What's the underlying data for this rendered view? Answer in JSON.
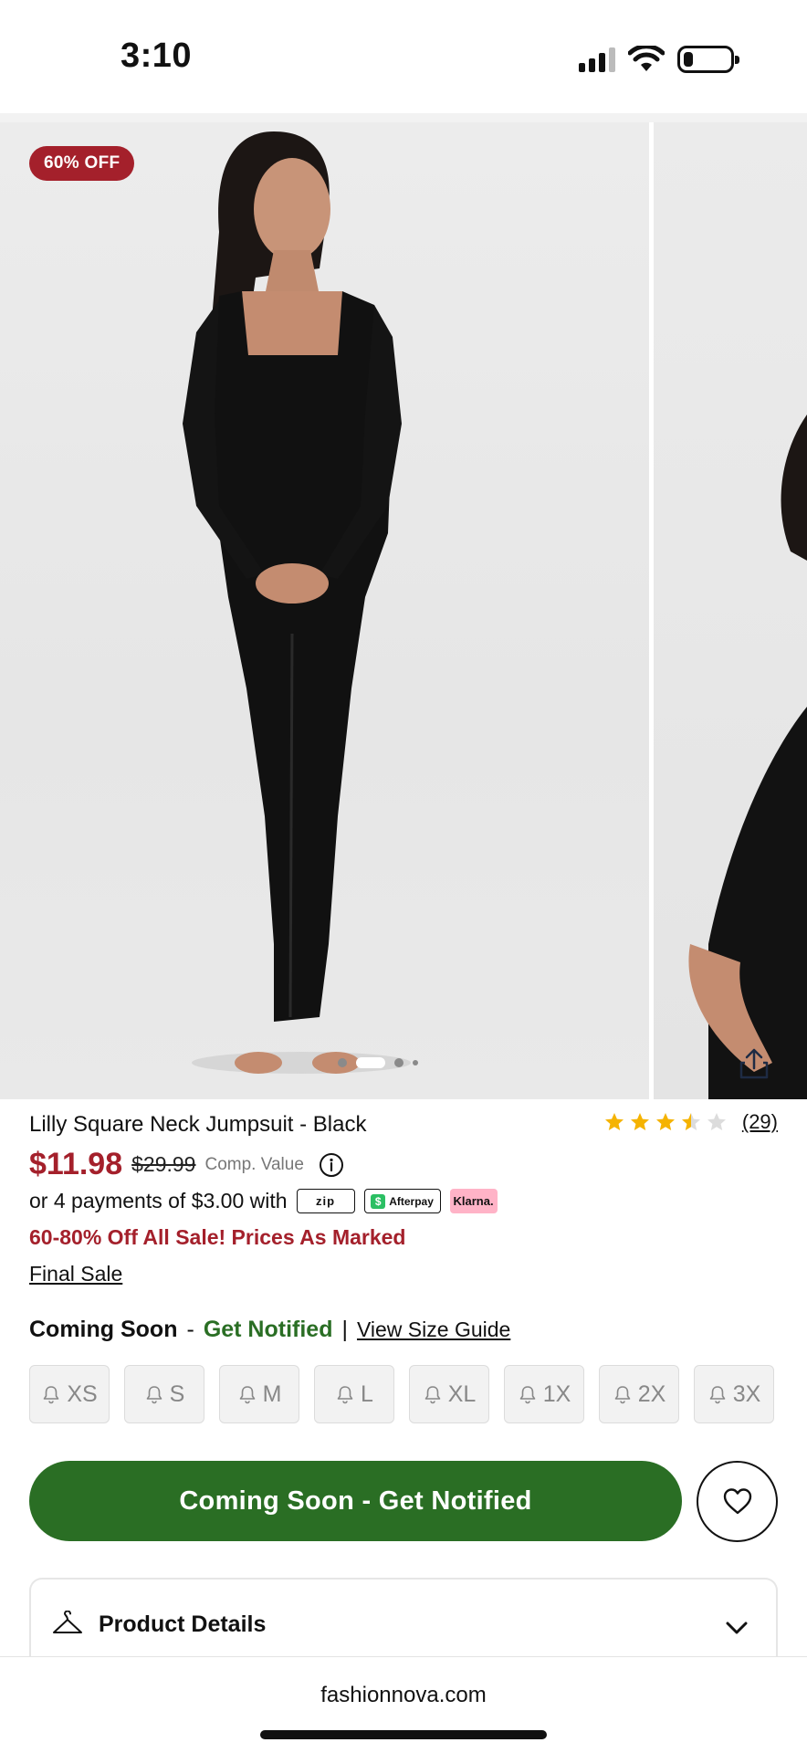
{
  "status_bar": {
    "time": "3:10",
    "battery_level": 0.2
  },
  "gallery": {
    "badge": "60% OFF",
    "slide_count": 4,
    "active_slide": 2
  },
  "product": {
    "title": "Lilly Square Neck Jumpsuit - Black",
    "rating": 3.5,
    "rating_max": 5,
    "review_count": "(29)",
    "price": "$11.98",
    "compare_price": "$29.99",
    "compare_label": "Comp. Value",
    "installments_text": "or 4 payments of $3.00 with",
    "payment_providers": {
      "zip": "zip",
      "afterpay": "Afterpay",
      "klarna": "Klarna."
    },
    "promo": "60-80% Off All Sale! Prices As Marked",
    "final_sale": "Final Sale"
  },
  "sizes_section": {
    "status": "Coming Soon",
    "separator_dash": "-",
    "notify_link": "Get Notified",
    "divider": "|",
    "size_guide": "View Size Guide",
    "sizes": [
      "XS",
      "S",
      "M",
      "L",
      "XL",
      "1X",
      "2X",
      "3X"
    ]
  },
  "actions": {
    "cta_label": "Coming Soon - Get Notified",
    "wishlist": "heart-icon"
  },
  "accordion": {
    "product_details": "Product Details"
  },
  "browser": {
    "url": "fashionnova.com"
  },
  "colors": {
    "sale_red": "#a4202b",
    "cta_green": "#2a6e24",
    "star_gold": "#f5b301"
  }
}
